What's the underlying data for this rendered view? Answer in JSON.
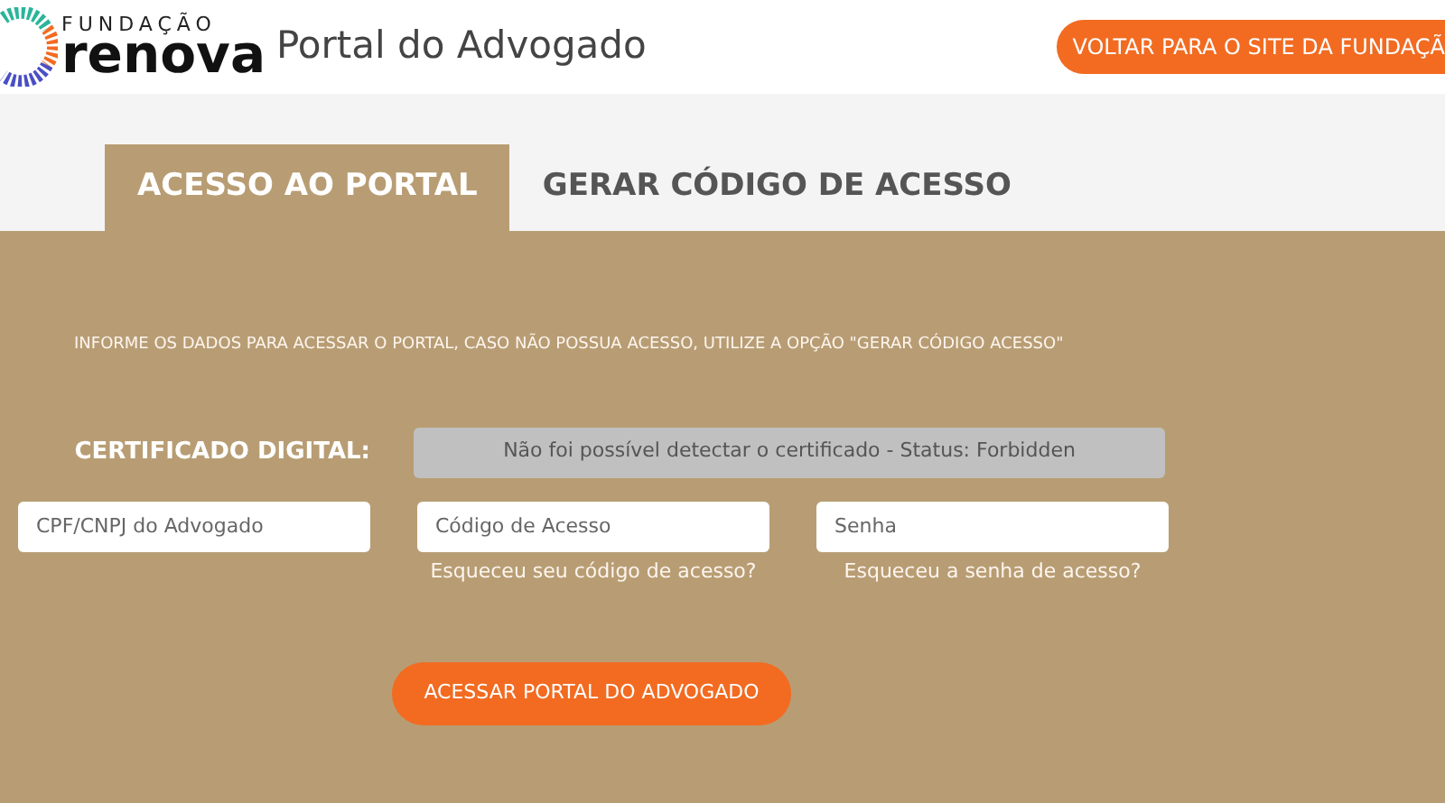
{
  "header": {
    "logo": {
      "small": "FUNDAÇÃO",
      "big": "renova"
    },
    "title": "Portal do Advogado",
    "back_button": "VOLTAR PARA O SITE DA FUNDAÇÃ"
  },
  "tabs": [
    {
      "label": "ACESSO AO PORTAL",
      "selected": true
    },
    {
      "label": "GERAR CÓDIGO DE ACESSO",
      "selected": false
    }
  ],
  "form": {
    "instructions": "INFORME OS DADOS PARA ACESSAR O PORTAL, CASO NÃO POSSUA ACESSO, UTILIZE A OPÇÃO \"GERAR CÓDIGO ACESSO\"",
    "certificate_label": "CERTIFICADO DIGITAL:",
    "certificate_status": "Não foi possível detectar o certificado - Status: Forbidden",
    "fields": [
      {
        "placeholder": "CPF/CNPJ do Advogado"
      },
      {
        "placeholder": "Código de Acesso",
        "help_link": "Esqueceu seu código de acesso?"
      },
      {
        "placeholder": "Senha",
        "help_link": "Esqueceu a senha de acesso?"
      }
    ],
    "submit": "ACESSAR PORTAL DO ADVOGADO"
  }
}
